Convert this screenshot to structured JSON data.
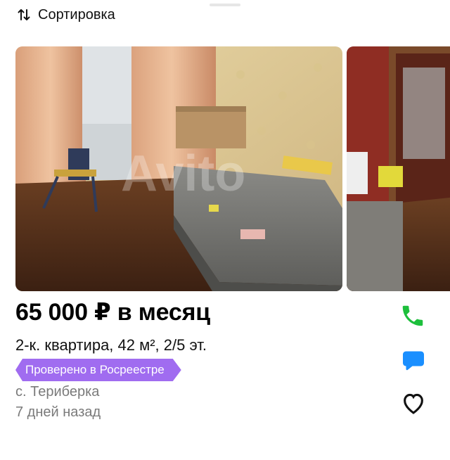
{
  "toolbar": {
    "sort_label": "Сортировка",
    "sort_icon": "sort-arrows-icon"
  },
  "listing": {
    "price": "65 000 ₽ в месяц",
    "title": "2-к. квартира, 42 м², 2/5 эт.",
    "badge": "Проверено в Росреестре",
    "location": "с. Териберка",
    "date": "7 дней назад",
    "watermark": "Avito",
    "photo_count_visible": 2
  },
  "actions": {
    "call_icon": "phone-icon",
    "message_icon": "message-icon",
    "favorite_icon": "heart-icon"
  },
  "colors": {
    "accent_green": "#1dbf3c",
    "accent_blue": "#1a8fff",
    "badge_purple": "#a06cf0",
    "secondary_text": "#7a7a7a"
  }
}
